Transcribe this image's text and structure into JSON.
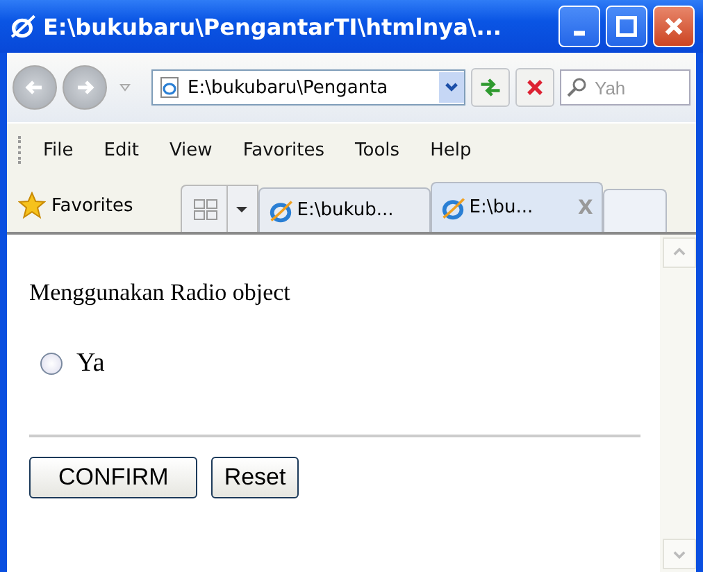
{
  "window": {
    "title": "E:\\bukubaru\\PengantarTI\\htmlnya\\..."
  },
  "address_bar": {
    "value": "E:\\bukubaru\\Penganta"
  },
  "search": {
    "placeholder": "Yah"
  },
  "menu": [
    "File",
    "Edit",
    "View",
    "Favorites",
    "Tools",
    "Help"
  ],
  "favorites": {
    "label": "Favorites"
  },
  "tabs": [
    {
      "label": "E:\\bukub...",
      "selected": false,
      "closable": false
    },
    {
      "label": "E:\\bu...",
      "selected": true,
      "closable": true
    }
  ],
  "tab_close": "X",
  "page": {
    "heading": "Menggunakan Radio object",
    "radios": [
      {
        "label": "Ya",
        "checked": false
      }
    ],
    "buttons": [
      "CONFIRM",
      "Reset"
    ]
  }
}
